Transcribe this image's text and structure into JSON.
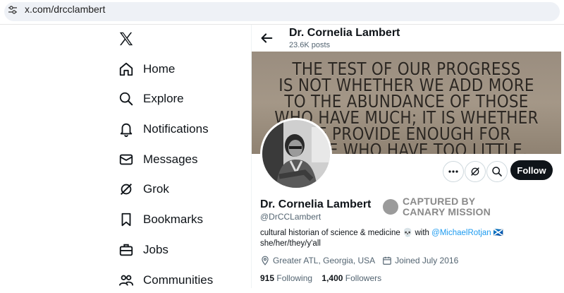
{
  "browser": {
    "url": "x.com/drcclambert",
    "tune_icon": "site-settings-icon"
  },
  "nav": {
    "logo": "x-logo-icon",
    "items": [
      {
        "label": "Home",
        "icon": "home-icon"
      },
      {
        "label": "Explore",
        "icon": "search-icon"
      },
      {
        "label": "Notifications",
        "icon": "bell-icon"
      },
      {
        "label": "Messages",
        "icon": "envelope-icon"
      },
      {
        "label": "Grok",
        "icon": "grok-icon"
      },
      {
        "label": "Bookmarks",
        "icon": "bookmark-icon"
      },
      {
        "label": "Jobs",
        "icon": "briefcase-icon"
      },
      {
        "label": "Communities",
        "icon": "people-icon"
      }
    ]
  },
  "header": {
    "name": "Dr. Cornelia Lambert",
    "posts": "23.6K posts"
  },
  "banner": {
    "lines": [
      "THE TEST OF OUR PROGRESS",
      "IS NOT WHETHER WE ADD MORE",
      "TO THE ABUNDANCE OF THOSE",
      "WHO HAVE MUCH; IT IS WHETHER",
      "WE PROVIDE ENOUGH FOR",
      "THOSE WHO HAVE TOO LITTLE."
    ]
  },
  "profile": {
    "name": "Dr. Cornelia Lambert",
    "handle": "@DrCCLambert",
    "stamp_line1": "CAPTURED BY",
    "stamp_line2": "CANARY MISSION",
    "bio_text": "cultural historian of science & medicine 💀 with ",
    "bio_mention": "@MichaelRotjan",
    "bio_flag": "🏴󠁧󠁢󠁳󠁣󠁴󠁿",
    "bio_line2": "she/her/they/y'all",
    "location": "Greater ATL, Georgia, USA",
    "joined": "Joined July 2016",
    "following_count": "915",
    "following_label": "Following",
    "followers_count": "1,400",
    "followers_label": "Followers",
    "follow_button": "Follow"
  },
  "colors": {
    "accent": "#1d9bf0",
    "text": "#0f1419",
    "muted": "#536471",
    "stamp": "#8a8a8a"
  }
}
